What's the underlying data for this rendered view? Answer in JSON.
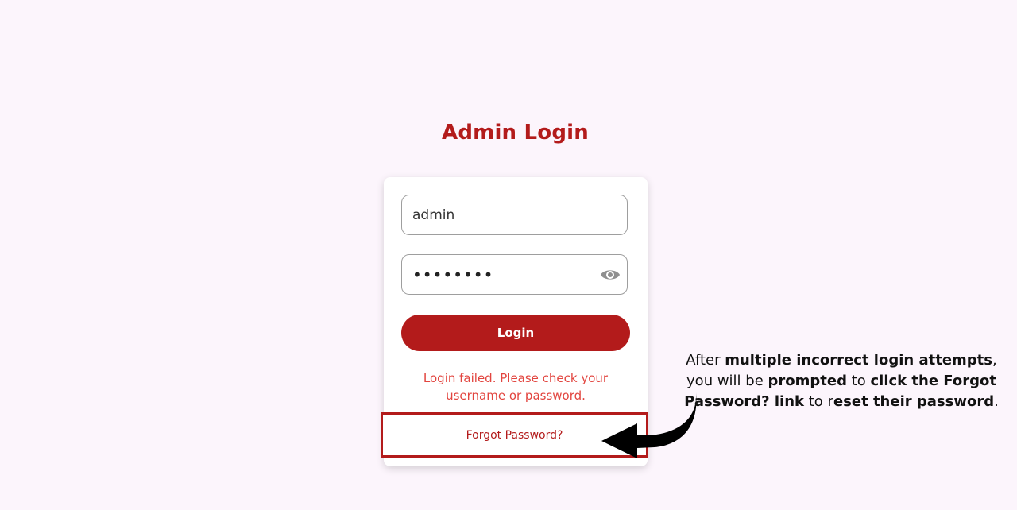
{
  "page": {
    "title": "Admin Login"
  },
  "form": {
    "username_value": "admin",
    "password_value": "password",
    "login_label": "Login",
    "error_text": "Login failed. Please check your username or password.",
    "forgot_label": "Forgot Password?"
  },
  "icons": {
    "password_toggle": "eye-icon",
    "pointer": "curved-arrow-icon"
  },
  "annotation": {
    "parts": [
      "After ",
      "multiple incorrect login attempts",
      ", you will be ",
      "prompted",
      " to ",
      "click the Forgot Password? link",
      " to r",
      "eset their password",
      "."
    ]
  },
  "colors": {
    "brand": "#b31b1b",
    "error": "#e2453f",
    "background": "#fcf5fc",
    "highlight_border": "#b31b1b"
  }
}
